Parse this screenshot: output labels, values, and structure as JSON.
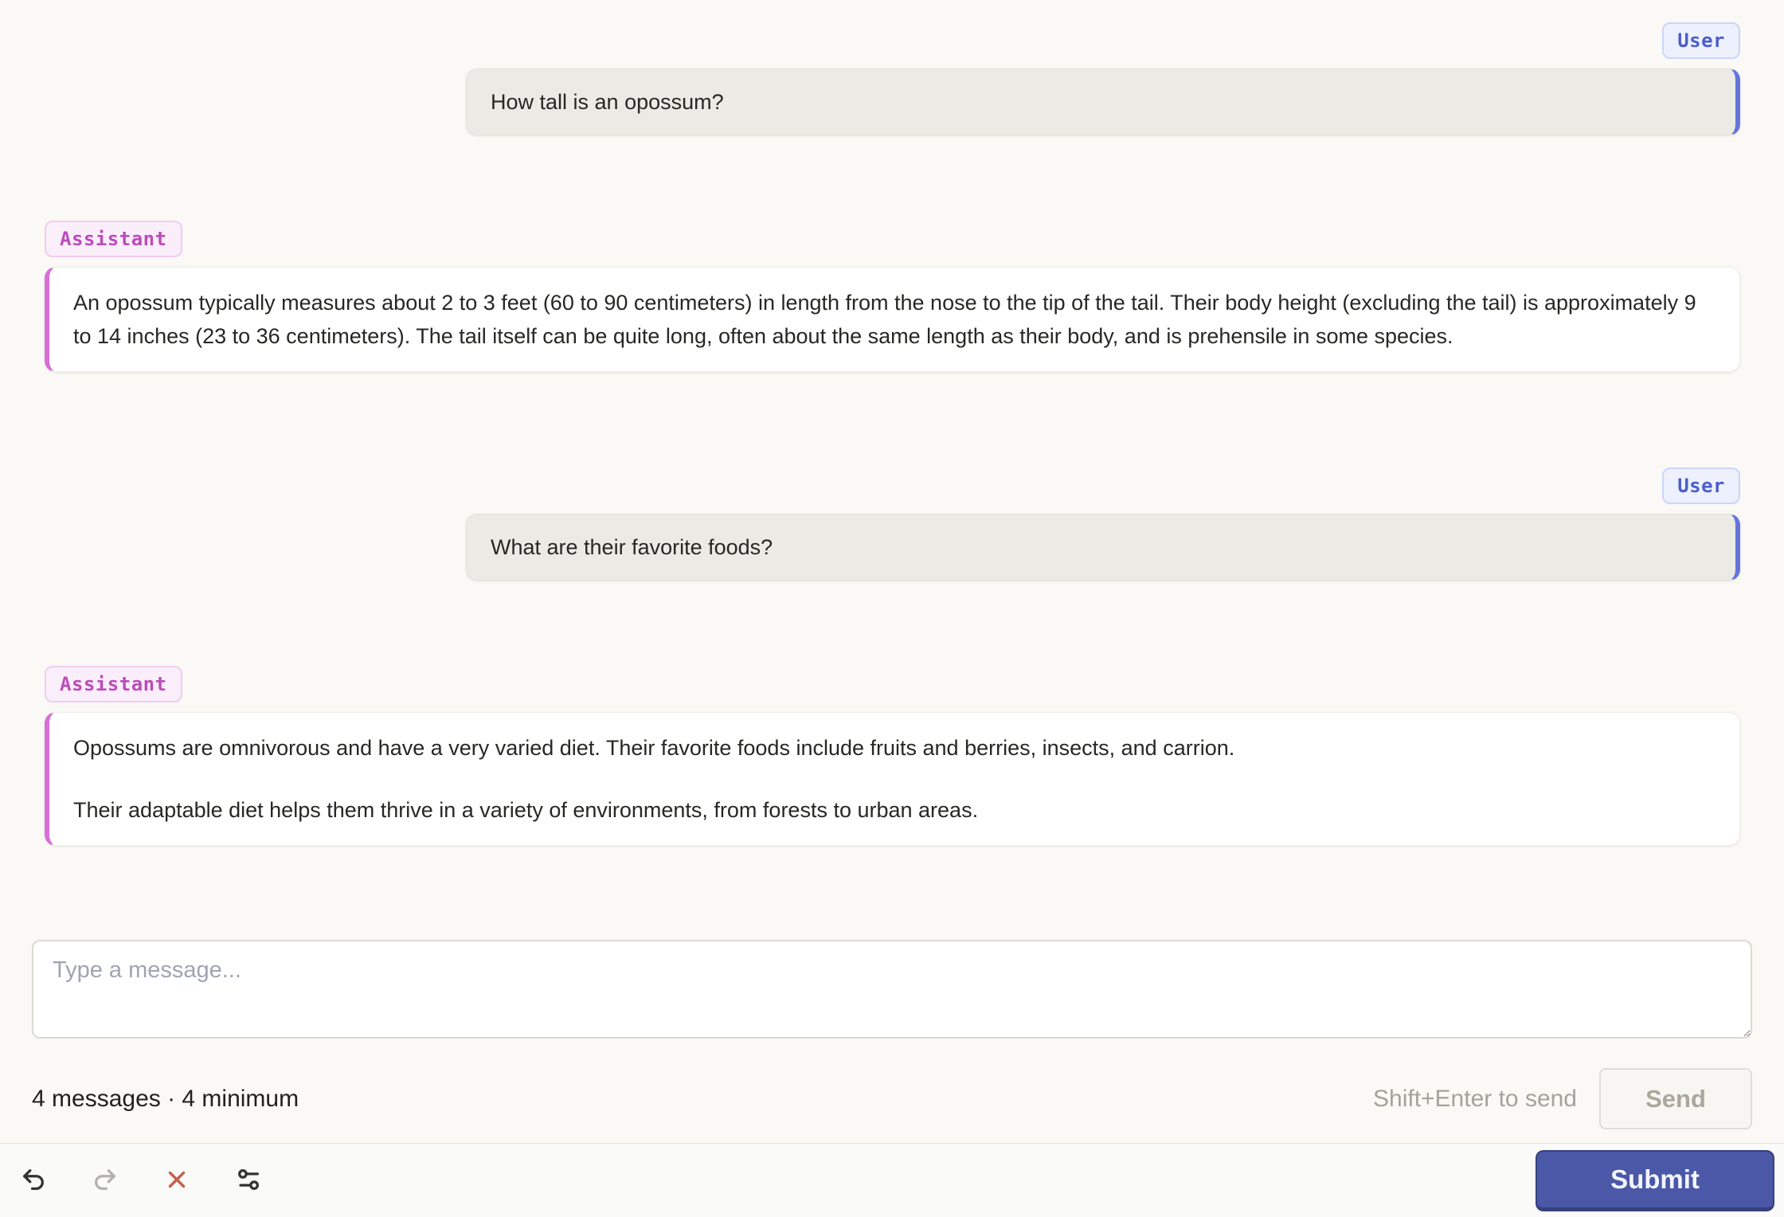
{
  "messages": [
    {
      "role": "User",
      "text": "How tall is an opossum?"
    },
    {
      "role": "Assistant",
      "paragraphs": [
        "An opossum typically measures about 2 to 3 feet (60 to 90 centimeters) in length from the nose to the tip of the tail. Their body height (excluding the tail) is approximately 9 to 14 inches (23 to 36 centimeters). The tail itself can be quite long, often about the same length as their body, and is prehensile in some species."
      ]
    },
    {
      "role": "User",
      "text": "What are their favorite foods?"
    },
    {
      "role": "Assistant",
      "paragraphs": [
        "Opossums are omnivorous and have a very varied diet. Their favorite foods include fruits and berries, insects, and carrion.",
        "Their adaptable diet helps them thrive in a variety of environments, from forests to urban areas."
      ]
    }
  ],
  "composer": {
    "placeholder": "Type a message...",
    "status": "4 messages · 4 minimum",
    "hint": "Shift+Enter to send",
    "send_label": "Send"
  },
  "toolbar": {
    "submit_label": "Submit",
    "icons": {
      "undo": "undo-arrow",
      "redo": "redo-arrow",
      "discard": "x-mark",
      "settings": "sliders-horizontal"
    }
  },
  "colors": {
    "page-bg": "#FAF9F5",
    "text": "#272724",
    "user-accent": "#4C5DC8",
    "user-stripe": "#6574DB",
    "assistant-accent-text": "#BB4CBB",
    "assistant-stripe": "#D76FD7",
    "submit-bg": "#4A58A7",
    "danger": "#C3604C"
  }
}
